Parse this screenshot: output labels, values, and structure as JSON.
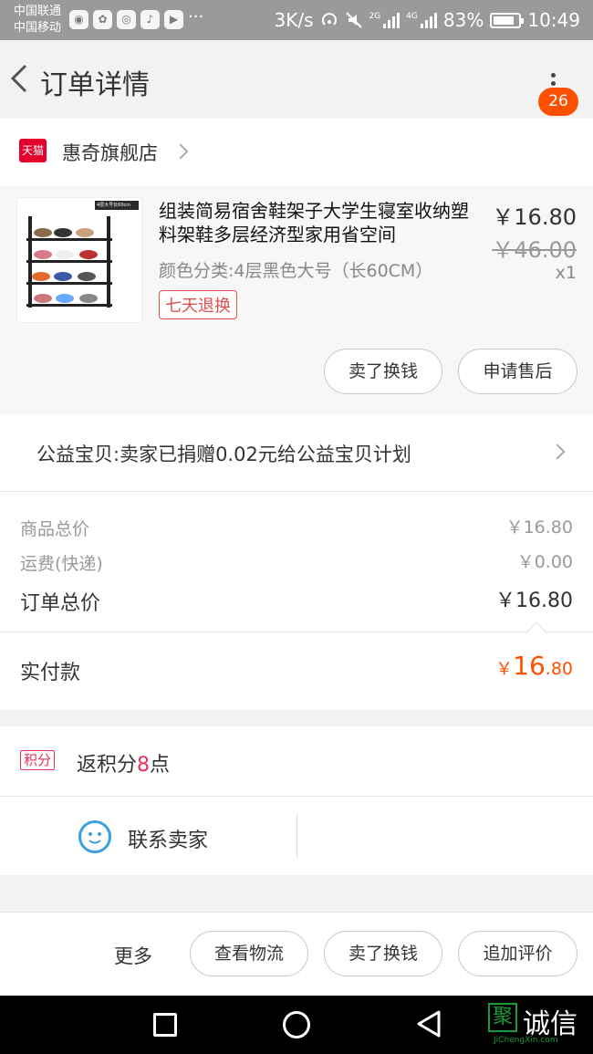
{
  "status": {
    "carrier1": "中国联通",
    "carrier2": "中国移动",
    "speed": "3K/s",
    "net1": "2G",
    "net2": "4G",
    "battery": "83%",
    "battery_level": 0.83,
    "time": "10:49",
    "app_icons": [
      "wechat-icon",
      "baidu-icon",
      "weibo-icon",
      "douyin-icon",
      "video-icon"
    ],
    "overflow": "···"
  },
  "nav": {
    "title": "订单详情",
    "badge": "26"
  },
  "shop": {
    "badge_label": "天猫",
    "name": "惠奇旗舰店"
  },
  "product": {
    "thumb_label": "4层大号长60cm",
    "title": "组装简易宿舍鞋架子大学生寝室收纳塑料架鞋多层经济型家用省空间",
    "spec": "颜色分类:4层黑色大号（长60CM）",
    "tag": "七天退换",
    "price": "￥16.80",
    "original_price": "￥46.00",
    "quantity": "x1",
    "btn_sell": "卖了换钱",
    "btn_after_sale": "申请售后"
  },
  "charity": {
    "text": "公益宝贝:卖家已捐赠0.02元给公益宝贝计划"
  },
  "summary": {
    "goods_label": "商品总价",
    "goods_value": "￥16.80",
    "shipping_label": "运费(快递)",
    "shipping_value": "￥0.00",
    "total_label": "订单总价",
    "total_value": "￥16.80"
  },
  "paid": {
    "label": "实付款",
    "currency": "￥",
    "int": "16",
    "dec": ".80"
  },
  "points": {
    "tag": "积分",
    "prefix": "返积分",
    "num": "8",
    "suffix": "点"
  },
  "contact": {
    "label": "联系卖家"
  },
  "actions": {
    "more": "更多",
    "logistics": "查看物流",
    "sell": "卖了换钱",
    "review": "追加评价"
  },
  "watermark": {
    "box": "聚",
    "word": "诚信",
    "sub": "JiChengXin.com"
  },
  "colors": {
    "accent": "#ff5000",
    "tmall": "#e4002b",
    "points": "#e8315a",
    "contact": "#3aa0e0"
  }
}
